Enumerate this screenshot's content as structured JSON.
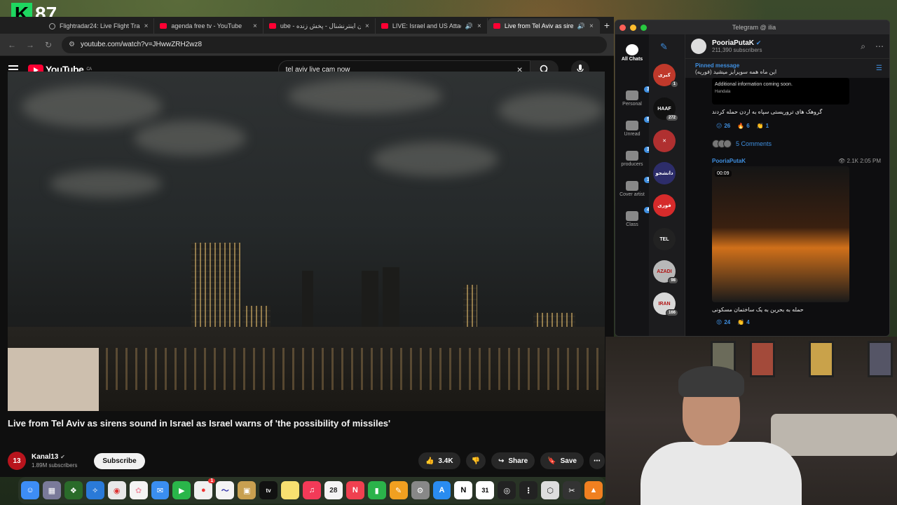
{
  "overlay": {
    "badge_letter": "K",
    "badge_number": "87"
  },
  "browser": {
    "tabs": [
      {
        "title": "Flightradar24: Live Flight Tra",
        "favicon": "globe-icon",
        "audio": false
      },
      {
        "title": "agenda free tv - YouTube",
        "favicon": "youtube-icon",
        "audio": false
      },
      {
        "title": "ube - ایران اینترنشنال - پخش زنده",
        "favicon": "youtube-icon",
        "audio": false
      },
      {
        "title": "LIVE: Israel and US Attack",
        "favicon": "youtube-icon",
        "audio": true
      },
      {
        "title": "Live from Tel Aviv as siren",
        "favicon": "youtube-icon",
        "audio": true,
        "active": true
      }
    ],
    "url": "youtube.com/watch?v=JHwwZRH2wz8"
  },
  "youtube": {
    "logo_text": "YouTube",
    "region": "CA",
    "search_value": "tel aviv live cam now",
    "video_title": "Live from Tel Aviv as sirens sound in Israel as Israel warns of 'the possibility of missiles'",
    "channel": {
      "name": "Kanal13",
      "subscribers": "1.89M subscribers",
      "avatar_text": "13"
    },
    "subscribe_label": "Subscribe",
    "likes": "3.4K",
    "share_label": "Share",
    "save_label": "Save"
  },
  "telegram": {
    "window_title": "Telegram @ ilia",
    "folders": [
      {
        "label": "All Chats",
        "badge": ""
      },
      {
        "label": "Personal",
        "badge": "395"
      },
      {
        "label": "Unread",
        "badge": "534"
      },
      {
        "label": "producers",
        "badge": "3"
      },
      {
        "label": "Cover artist",
        "badge": "1"
      },
      {
        "label": "Class",
        "badge": "4"
      }
    ],
    "chats": [
      {
        "text": "کیری",
        "count": "1",
        "color": "#c0392b"
      },
      {
        "text": "HAAF",
        "count": "272",
        "color": "#111111"
      },
      {
        "text": "✕",
        "count": "",
        "color": "#b03030"
      },
      {
        "text": "دانشجو",
        "count": "",
        "color": "#2d2d6a"
      },
      {
        "text": "فوری",
        "count": "",
        "color": "#d62b2b"
      },
      {
        "text": "TEL",
        "count": "",
        "color": "#222222"
      },
      {
        "text": "AZADI",
        "count": "98",
        "color": "#b8b8b8"
      },
      {
        "text": "IRAN",
        "count": "166",
        "color": "#d8d8d8"
      }
    ],
    "channel_name": "PooriaPutaK",
    "channel_subscribers": "211,390 subscribers",
    "pinned_label": "Pinned message",
    "pinned_text": "این ماه همه سوپرایز میشید (فوریه)",
    "msg1": {
      "image_text": "Additional information coming soon.",
      "image_sign": "Handala",
      "caption": "گروهک های تروریستی سپاه به اردن حمله کردند",
      "reactions": [
        {
          "emoji": "😕",
          "count": "26"
        },
        {
          "emoji": "🔥",
          "count": "6"
        },
        {
          "emoji": "👏",
          "count": "1"
        }
      ],
      "comments": "5 Comments"
    },
    "msg2": {
      "author": "PooriaPutaK",
      "views": "2.1K 2:05 PM",
      "duration": "00:09",
      "caption": "حمله به بحرین به یک ساختمان مسکونی",
      "reactions": [
        {
          "emoji": "😡",
          "count": "24"
        },
        {
          "emoji": "👏",
          "count": "4"
        }
      ]
    }
  },
  "dock": {
    "apps": [
      "finder",
      "launchpad",
      "stash",
      "safari",
      "chrome",
      "photos",
      "mail",
      "facetime",
      "messages",
      "freeform",
      "preview",
      "appletv",
      "notes",
      "music",
      "calendar",
      "news",
      "numbers",
      "pages",
      "settings",
      "appstore",
      "notion",
      "calendar2",
      "logic",
      "bitwig",
      "ableton",
      "capcut",
      "vlc",
      "garageband"
    ],
    "calendar_day": "28",
    "notif_badge": "1",
    "appletv_label": "tv"
  }
}
